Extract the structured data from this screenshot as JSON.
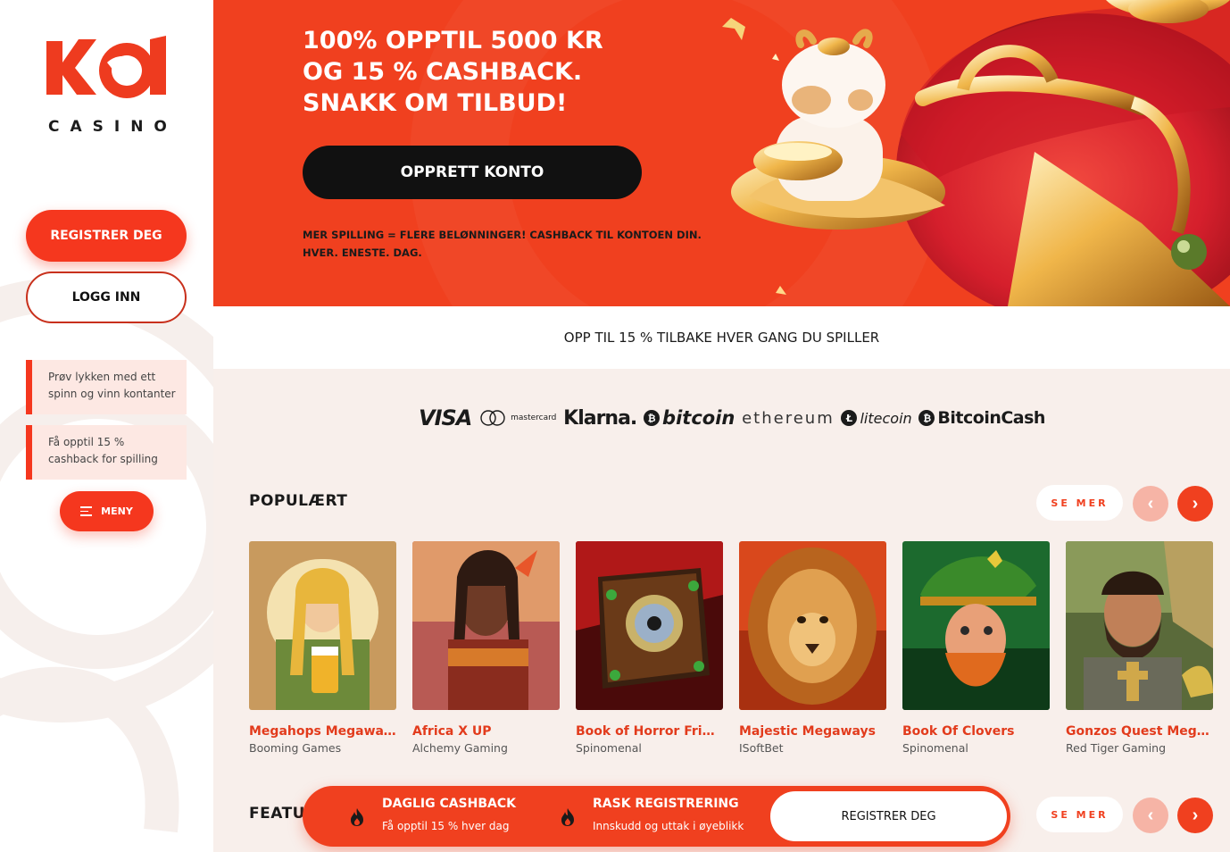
{
  "brand": {
    "logo_text": "KOI",
    "logo_sub": "CASINO",
    "accent": "#f0401f",
    "dark": "#111111",
    "cream": "#f8efeb"
  },
  "sidebar": {
    "register_label": "REGISTRER DEG",
    "login_label": "LOGG INN",
    "promos": [
      {
        "text": "Prøv lykken med ett spinn og vinn kontanter"
      },
      {
        "text": "Få opptil 15 % cashback for spilling"
      }
    ],
    "menu_label": "MENY",
    "menu_icon": "menu-lines-icon"
  },
  "hero": {
    "title_lines": [
      "100% OPPTIL 5000 KR",
      "OG 15 % CASHBACK.",
      "SNAKK OM TILBUD!"
    ],
    "cta_label": "OPPRETT KONTO",
    "sub_lines": [
      "MER SPILLING = FLERE BELØNNINGER! CASHBACK TIL KONTOEN DIN.",
      "HVER. ENESTE. DAG."
    ]
  },
  "strip": {
    "text": "OPP TIL 15 % TILBAKE HVER GANG DU SPILLER"
  },
  "payments": [
    {
      "name": "VISA",
      "icon": "visa-logo"
    },
    {
      "name": "mastercard",
      "icon": "mastercard-logo"
    },
    {
      "name": "Klarna.",
      "icon": "klarna-logo"
    },
    {
      "name": "bitcoin",
      "icon": "bitcoin-logo"
    },
    {
      "name": "ethereum",
      "icon": "ethereum-logo"
    },
    {
      "name": "litecoin",
      "icon": "litecoin-logo"
    },
    {
      "name": "BitcoinCash",
      "icon": "bitcoincash-logo"
    }
  ],
  "popular": {
    "title": "POPULÆRT",
    "see_more": "SE MER",
    "games": [
      {
        "name": "Megahops Megaways",
        "provider": "Booming Games"
      },
      {
        "name": "Africa X UP",
        "provider": "Alchemy Gaming"
      },
      {
        "name": "Book of Horror Friday...",
        "provider": "Spinomenal"
      },
      {
        "name": "Majestic Megaways",
        "provider": "ISoftBet"
      },
      {
        "name": "Book Of Clovers",
        "provider": "Spinomenal"
      },
      {
        "name": "Gonzos Quest MegaW...",
        "provider": "Red Tiger Gaming"
      }
    ]
  },
  "featured": {
    "title": "FEATURED",
    "see_more": "SE MER"
  },
  "bottom_bar": {
    "item1_title": "DAGLIG CASHBACK",
    "item1_sub": "Få opptil 15 % hver dag",
    "item2_title": "RASK REGISTRERING",
    "item2_sub": "Innskudd og uttak i øyeblikk",
    "register_label": "REGISTRER DEG",
    "icon": "fire-icon"
  }
}
